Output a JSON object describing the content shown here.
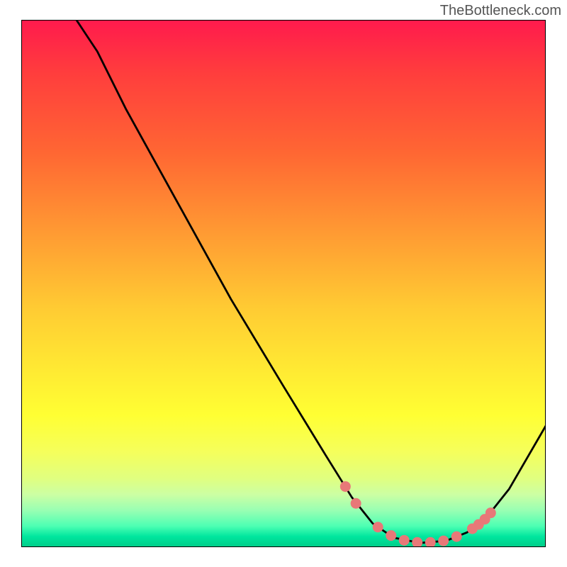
{
  "watermark_text": "TheBottleneck.com",
  "chart_data": {
    "type": "line",
    "title": "",
    "xlabel": "",
    "ylabel": "",
    "xlim": [
      0,
      100
    ],
    "ylim": [
      0,
      100
    ],
    "curve_points": [
      {
        "x": 10.5,
        "y": 100
      },
      {
        "x": 14.5,
        "y": 94
      },
      {
        "x": 20,
        "y": 83
      },
      {
        "x": 30,
        "y": 65
      },
      {
        "x": 40,
        "y": 47
      },
      {
        "x": 50,
        "y": 30.5
      },
      {
        "x": 58,
        "y": 17.5
      },
      {
        "x": 63,
        "y": 9.5
      },
      {
        "x": 67,
        "y": 4.5
      },
      {
        "x": 71,
        "y": 1.8
      },
      {
        "x": 76,
        "y": 0.8
      },
      {
        "x": 81,
        "y": 1.2
      },
      {
        "x": 85,
        "y": 2.8
      },
      {
        "x": 89,
        "y": 6
      },
      {
        "x": 93,
        "y": 11
      },
      {
        "x": 100,
        "y": 23
      }
    ],
    "marker_points": [
      {
        "x": 61.8,
        "y": 11.5
      },
      {
        "x": 63.8,
        "y": 8.3
      },
      {
        "x": 68,
        "y": 3.8
      },
      {
        "x": 70.5,
        "y": 2.2
      },
      {
        "x": 73,
        "y": 1.3
      },
      {
        "x": 75.5,
        "y": 0.9
      },
      {
        "x": 78,
        "y": 0.9
      },
      {
        "x": 80.5,
        "y": 1.2
      },
      {
        "x": 83,
        "y": 2
      },
      {
        "x": 86,
        "y": 3.5
      },
      {
        "x": 87.2,
        "y": 4.3
      },
      {
        "x": 88.4,
        "y": 5.3
      },
      {
        "x": 89.5,
        "y": 6.5
      }
    ],
    "marker_color": "#e87878",
    "curve_color": "#000000",
    "curve_width": 2.8
  }
}
